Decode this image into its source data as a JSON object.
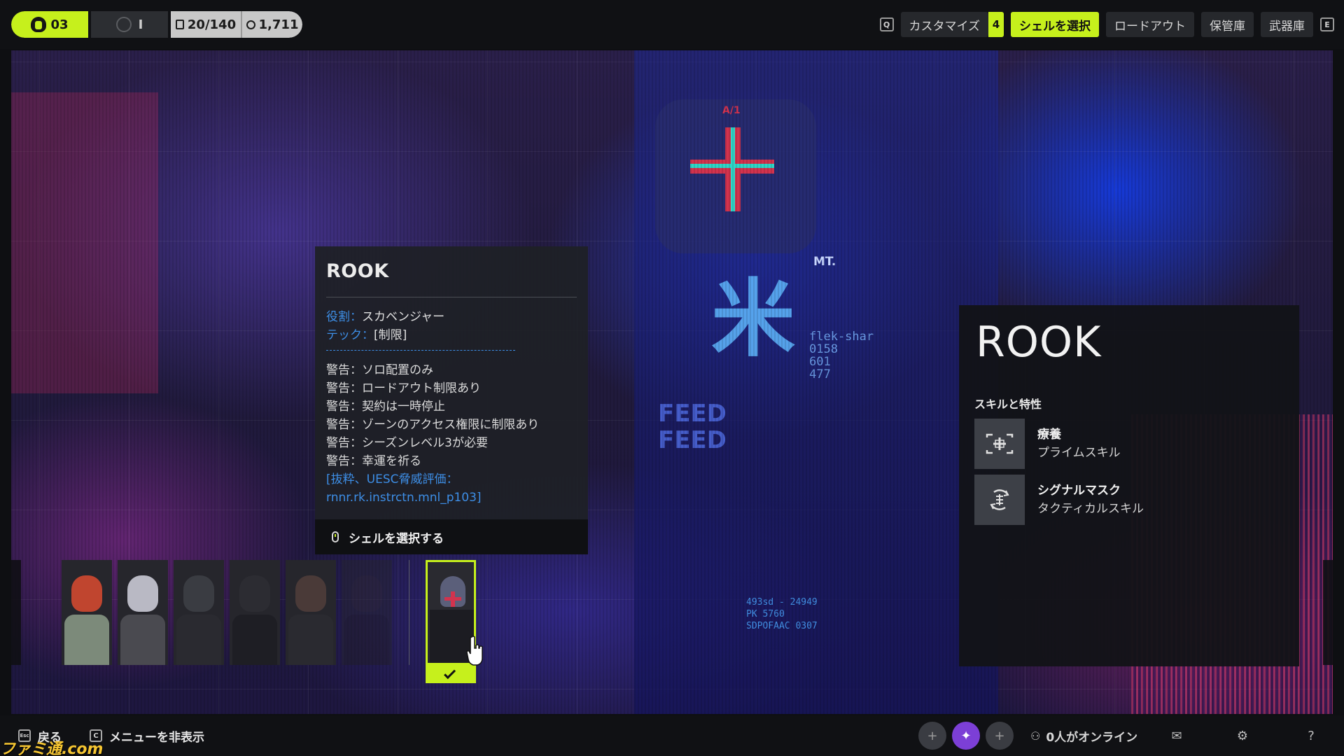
{
  "topbar": {
    "level": "03",
    "rank": "I",
    "inventory": "20/140",
    "currency": "1,711",
    "nav": {
      "left_key": "Q",
      "right_key": "E",
      "customize": "カスタマイズ",
      "customize_badge": "4",
      "select_shell": "シェルを選択",
      "loadout": "ロードアウト",
      "vault": "保管庫",
      "armory": "武器庫"
    }
  },
  "scene_text": {
    "flek": "flek-shar",
    "flek_num1": "0158",
    "flek_num2": "601",
    "flek_num3": "477",
    "feed1": "FEED",
    "feed2": "FEED",
    "code1": "493sd - 24949",
    "code2": "PK 5760",
    "code3": "SDPOFAAC 0307",
    "mt": "MT.",
    "a1": "A/1"
  },
  "tooltip": {
    "title": "ROOK",
    "role_key": "役割：",
    "role_value": "スカベンジャー",
    "tech_key": "テック：",
    "tech_value": "[制限]",
    "warnings": [
      "警告：ソロ配置のみ",
      "警告：ロードアウト制限あり",
      "警告：契約は一時停止",
      "警告：ゾーンのアクセス権限に制限あり",
      "警告：シーズンレベル3が必要",
      "警告：幸運を祈る"
    ],
    "excerpt_line1": "[抜粋、UESC脅威評価：",
    "excerpt_line2": "rnnr.rk.instrctn.mnl_p103]",
    "action": "シェルを選択する"
  },
  "info_panel": {
    "title": "ROOK",
    "section": "スキルと特性",
    "skills": [
      {
        "name": "療養",
        "type": "プライムスキル",
        "icon": "heal-icon"
      },
      {
        "name": "シグナルマスク",
        "type": "タクティカルスキル",
        "icon": "signal-mask-icon"
      }
    ]
  },
  "shells": [
    {
      "name": "shell-1",
      "head": "#c0452f",
      "body": "#7c8a7a"
    },
    {
      "name": "shell-2",
      "head": "#b9b9c4",
      "body": "#4a4a50"
    },
    {
      "name": "shell-3",
      "head": "#3a3c42",
      "body": "#2a2a30"
    },
    {
      "name": "shell-4",
      "head": "#2c2c32",
      "body": "#1e1e24"
    },
    {
      "name": "shell-5",
      "head": "#4a3a38",
      "body": "#2a2a30"
    },
    {
      "name": "shell-6",
      "head": "#2e2a2a",
      "body": "#201e22"
    }
  ],
  "bottombar": {
    "back_key": "Esc",
    "back": "戻る",
    "hide_key": "C",
    "hide_menu": "メニューを非表示",
    "online": "0人がオンライン",
    "watermark": "ファミ通.com"
  },
  "colors": {
    "accent": "#c6f01c",
    "link": "#3d8ee6",
    "panel": "#1e2026"
  }
}
